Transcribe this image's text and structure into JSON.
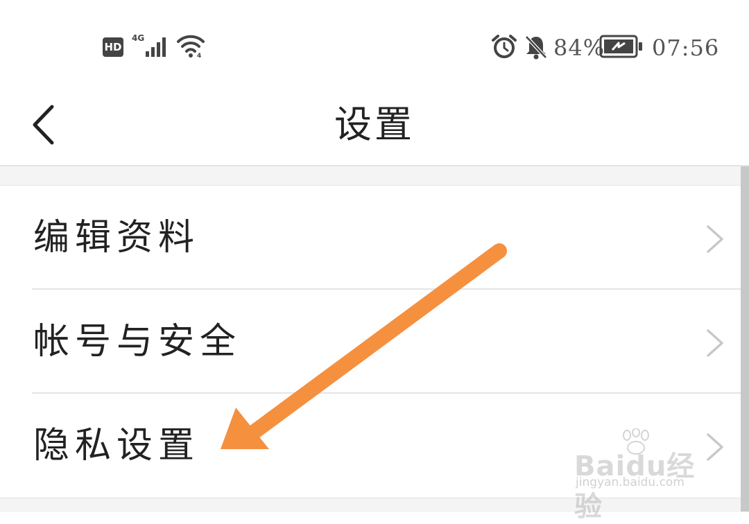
{
  "status_bar": {
    "hd_badge": "HD",
    "network_type": "4G",
    "battery_percent": "84%",
    "battery_level": 0.84,
    "time": "07:56",
    "icons": [
      "hd-icon",
      "signal-icon",
      "wifi-icon",
      "alarm-icon",
      "mute-bell-icon",
      "battery-charging-icon"
    ]
  },
  "header": {
    "back_icon": "chevron-left-icon",
    "title": "设置"
  },
  "settings_list": {
    "items": [
      {
        "label": "编辑资料",
        "icon": "chevron-right-icon"
      },
      {
        "label": "帐号与安全",
        "icon": "chevron-right-icon"
      },
      {
        "label": "隐私设置",
        "icon": "chevron-right-icon"
      }
    ]
  },
  "annotation": {
    "type": "arrow",
    "color": "#f5903f",
    "points_to": "隐私设置"
  },
  "watermark": {
    "brand": "Baidu经验",
    "url": "jingyan.baidu.com"
  }
}
